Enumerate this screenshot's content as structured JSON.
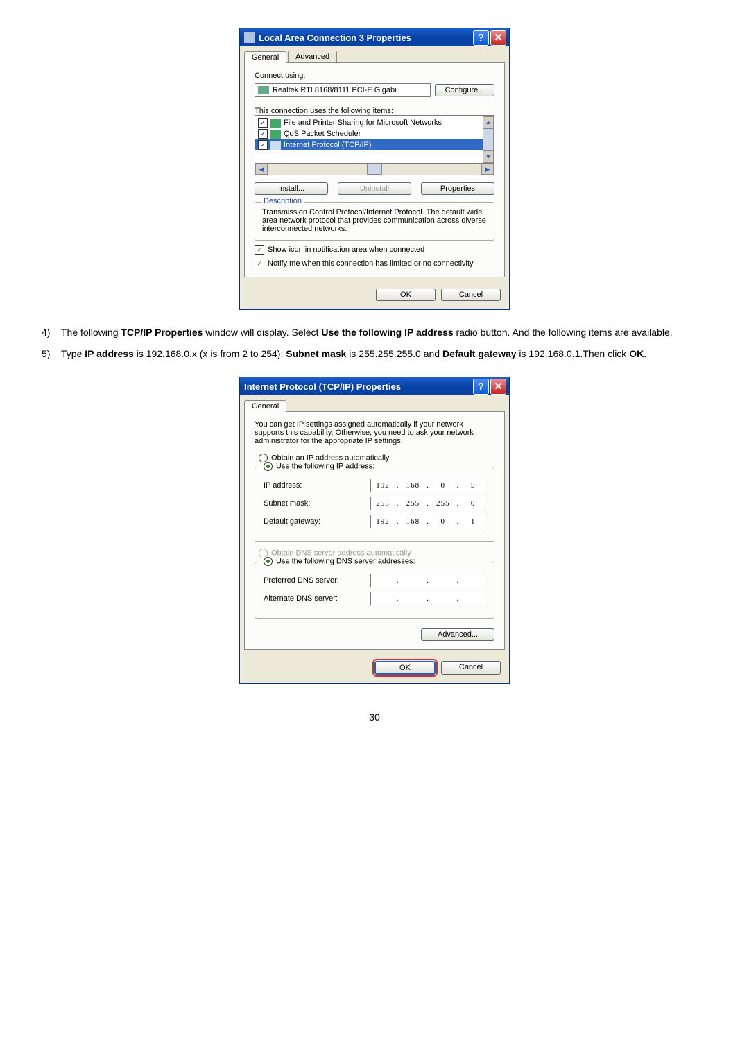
{
  "dialog1": {
    "title": "Local Area Connection 3 Properties",
    "tabs": [
      "General",
      "Advanced"
    ],
    "connect_using_label": "Connect using:",
    "adapter": "Realtek RTL8168/8111 PCI-E Gigabi",
    "configure_btn": "Configure...",
    "items_label": "This connection uses the following items:",
    "items": [
      {
        "label": "File and Printer Sharing for Microsoft Networks",
        "checked": true,
        "selected": false
      },
      {
        "label": "QoS Packet Scheduler",
        "checked": true,
        "selected": false
      },
      {
        "label": "Internet Protocol (TCP/IP)",
        "checked": true,
        "selected": true
      }
    ],
    "install_btn": "Install...",
    "uninstall_btn": "Uninstall",
    "properties_btn": "Properties",
    "desc_title": "Description",
    "desc_text": "Transmission Control Protocol/Internet Protocol. The default wide area network protocol that provides communication across diverse interconnected networks.",
    "chk_showicon": "Show icon in notification area when connected",
    "chk_notify": "Notify me when this connection has limited or no connectivity",
    "ok_btn": "OK",
    "cancel_btn": "Cancel"
  },
  "instructions": {
    "item4_num": "4)",
    "item4_t1": "The following ",
    "item4_b1": "TCP/IP Properties",
    "item4_t2": " window will display. Select ",
    "item4_b2": "Use the following IP address",
    "item4_t3": " radio button. And the following items are available.",
    "item5_num": "5)",
    "item5_t1": "Type ",
    "item5_b1": "IP address",
    "item5_t2": " is 192.168.0.x (x is from 2 to 254), ",
    "item5_b2": "Subnet mask",
    "item5_t3": " is 255.255.255.0 and ",
    "item5_b3": "Default gateway",
    "item5_t4": " is 192.168.0.1.Then click ",
    "item5_b4": "OK",
    "item5_t5": "."
  },
  "dialog2": {
    "title": "Internet Protocol (TCP/IP) Properties",
    "tab": "General",
    "intro": "You can get IP settings assigned automatically if your network supports this capability. Otherwise, you need to ask your network administrator for the appropriate IP settings.",
    "r_auto_ip": "Obtain an IP address automatically",
    "r_use_ip": "Use the following IP address:",
    "ip_label": "IP address:",
    "ip_value": [
      "192",
      "168",
      "0",
      "5"
    ],
    "mask_label": "Subnet mask:",
    "mask_value": [
      "255",
      "255",
      "255",
      "0"
    ],
    "gw_label": "Default gateway:",
    "gw_value": [
      "192",
      "168",
      "0",
      "1"
    ],
    "r_auto_dns": "Obtain DNS server address automatically",
    "r_use_dns": "Use the following DNS server addresses:",
    "pref_dns_label": "Preferred DNS server:",
    "alt_dns_label": "Alternate DNS server:",
    "advanced_btn": "Advanced...",
    "ok_btn": "OK",
    "cancel_btn": "Cancel"
  },
  "page_number": "30"
}
